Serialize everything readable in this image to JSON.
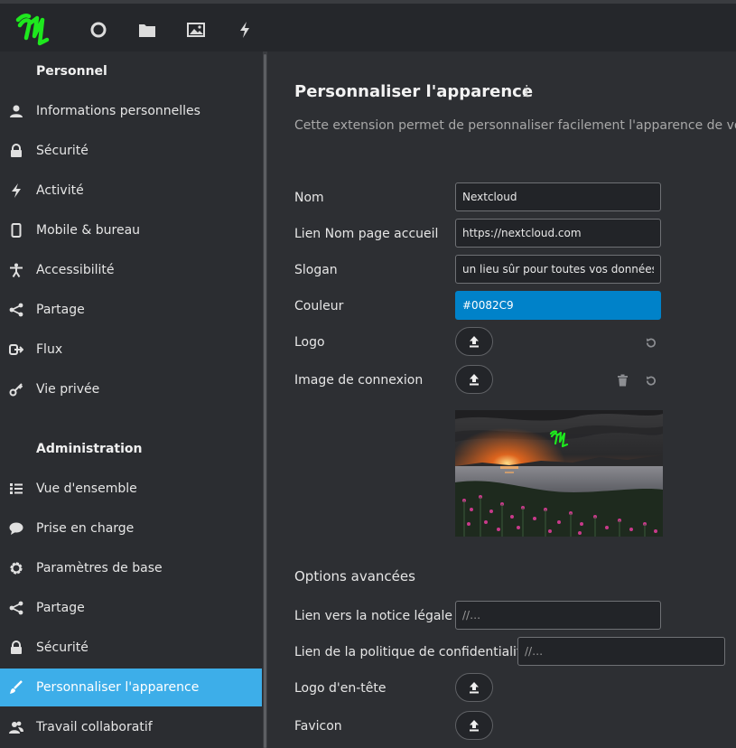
{
  "header": {
    "apps": [
      {
        "icon": "dashboard-icon"
      },
      {
        "icon": "files-icon"
      },
      {
        "icon": "photos-icon"
      },
      {
        "icon": "activity-icon"
      }
    ]
  },
  "sidebar": {
    "personal_heading": "Personnel",
    "personal_items": [
      {
        "label": "Informations personnelles",
        "icon": "user-icon"
      },
      {
        "label": "Sécurité",
        "icon": "lock-icon"
      },
      {
        "label": "Activité",
        "icon": "lightning-icon"
      },
      {
        "label": "Mobile & bureau",
        "icon": "phone-icon"
      },
      {
        "label": "Accessibilité",
        "icon": "accessibility-icon"
      },
      {
        "label": "Partage",
        "icon": "share-icon"
      },
      {
        "label": "Flux",
        "icon": "flow-icon"
      },
      {
        "label": "Vie privée",
        "icon": "key-icon"
      }
    ],
    "admin_heading": "Administration",
    "admin_items": [
      {
        "label": "Vue d'ensemble",
        "icon": "list-icon"
      },
      {
        "label": "Prise en charge",
        "icon": "chat-bubble-icon"
      },
      {
        "label": "Paramètres de base",
        "icon": "gear-icon"
      },
      {
        "label": "Partage",
        "icon": "share-icon"
      },
      {
        "label": "Sécurité",
        "icon": "lock-icon"
      },
      {
        "label": "Personnaliser l'apparence",
        "icon": "paint-brush-icon",
        "active": true
      },
      {
        "label": "Travail collaboratif",
        "icon": "group-icon"
      }
    ]
  },
  "main": {
    "title": "Personnaliser l'apparence",
    "info_glyph": "i",
    "description": "Cette extension permet de personnaliser facilement l'apparence de votre i",
    "fields": {
      "name_label": "Nom",
      "name_value": "Nextcloud",
      "url_label": "Lien Nom page accueil",
      "url_value": "https://nextcloud.com",
      "slogan_label": "Slogan",
      "slogan_value": "un lieu sûr pour toutes vos données",
      "color_label": "Couleur",
      "color_value": "#0082C9",
      "logo_label": "Logo",
      "login_image_label": "Image de connexion"
    },
    "advanced_heading": "Options avancées",
    "advanced": {
      "legal_label": "Lien vers la notice légale",
      "legal_placeholder": "//…",
      "privacy_label": "Lien de la politique de confidentialité",
      "privacy_placeholder": "//…",
      "header_logo_label": "Logo d'en-tête",
      "favicon_label": "Favicon"
    }
  },
  "colors": {
    "accent": "#3daee9",
    "theme_color": "#0082C9",
    "logo_green": "#1ee81e"
  }
}
